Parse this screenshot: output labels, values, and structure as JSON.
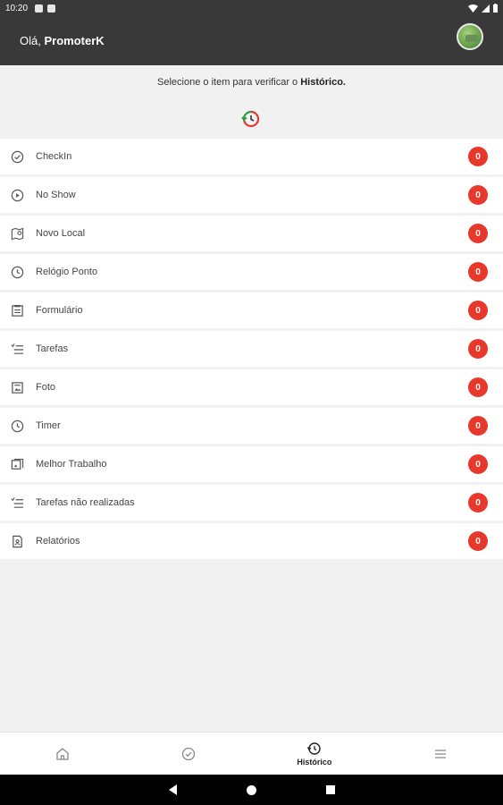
{
  "status_bar": {
    "time": "10:20"
  },
  "header": {
    "greeting_prefix": "Olá,",
    "user_name": "PromoterK"
  },
  "intro": {
    "text_prefix": "Selecione o item para verificar o",
    "text_bold": "Histórico."
  },
  "items": [
    {
      "label": "CheckIn",
      "count": "0",
      "icon": "check-circle-icon"
    },
    {
      "label": "No Show",
      "count": "0",
      "icon": "play-circle-icon"
    },
    {
      "label": "Novo Local",
      "count": "0",
      "icon": "map-pin-icon"
    },
    {
      "label": "Relógio Ponto",
      "count": "0",
      "icon": "clock-icon"
    },
    {
      "label": "Formulário",
      "count": "0",
      "icon": "form-icon"
    },
    {
      "label": "Tarefas",
      "count": "0",
      "icon": "task-list-icon"
    },
    {
      "label": "Foto",
      "count": "0",
      "icon": "photo-icon"
    },
    {
      "label": "Timer",
      "count": "0",
      "icon": "timer-icon"
    },
    {
      "label": "Melhor Trabalho",
      "count": "0",
      "icon": "best-work-icon"
    },
    {
      "label": "Tarefas não realizadas",
      "count": "0",
      "icon": "task-list-icon"
    },
    {
      "label": "Relatórios",
      "count": "0",
      "icon": "report-icon"
    }
  ],
  "bottom_nav": {
    "tabs": [
      {
        "label": "",
        "icon": "home-icon"
      },
      {
        "label": "",
        "icon": "check-circle-icon"
      },
      {
        "label": "Histórico",
        "icon": "history-icon",
        "active": true
      },
      {
        "label": "",
        "icon": "menu-icon"
      }
    ]
  },
  "colors": {
    "header_bg": "#393939",
    "badge": "#e8382c",
    "background": "#f1f1f1"
  }
}
